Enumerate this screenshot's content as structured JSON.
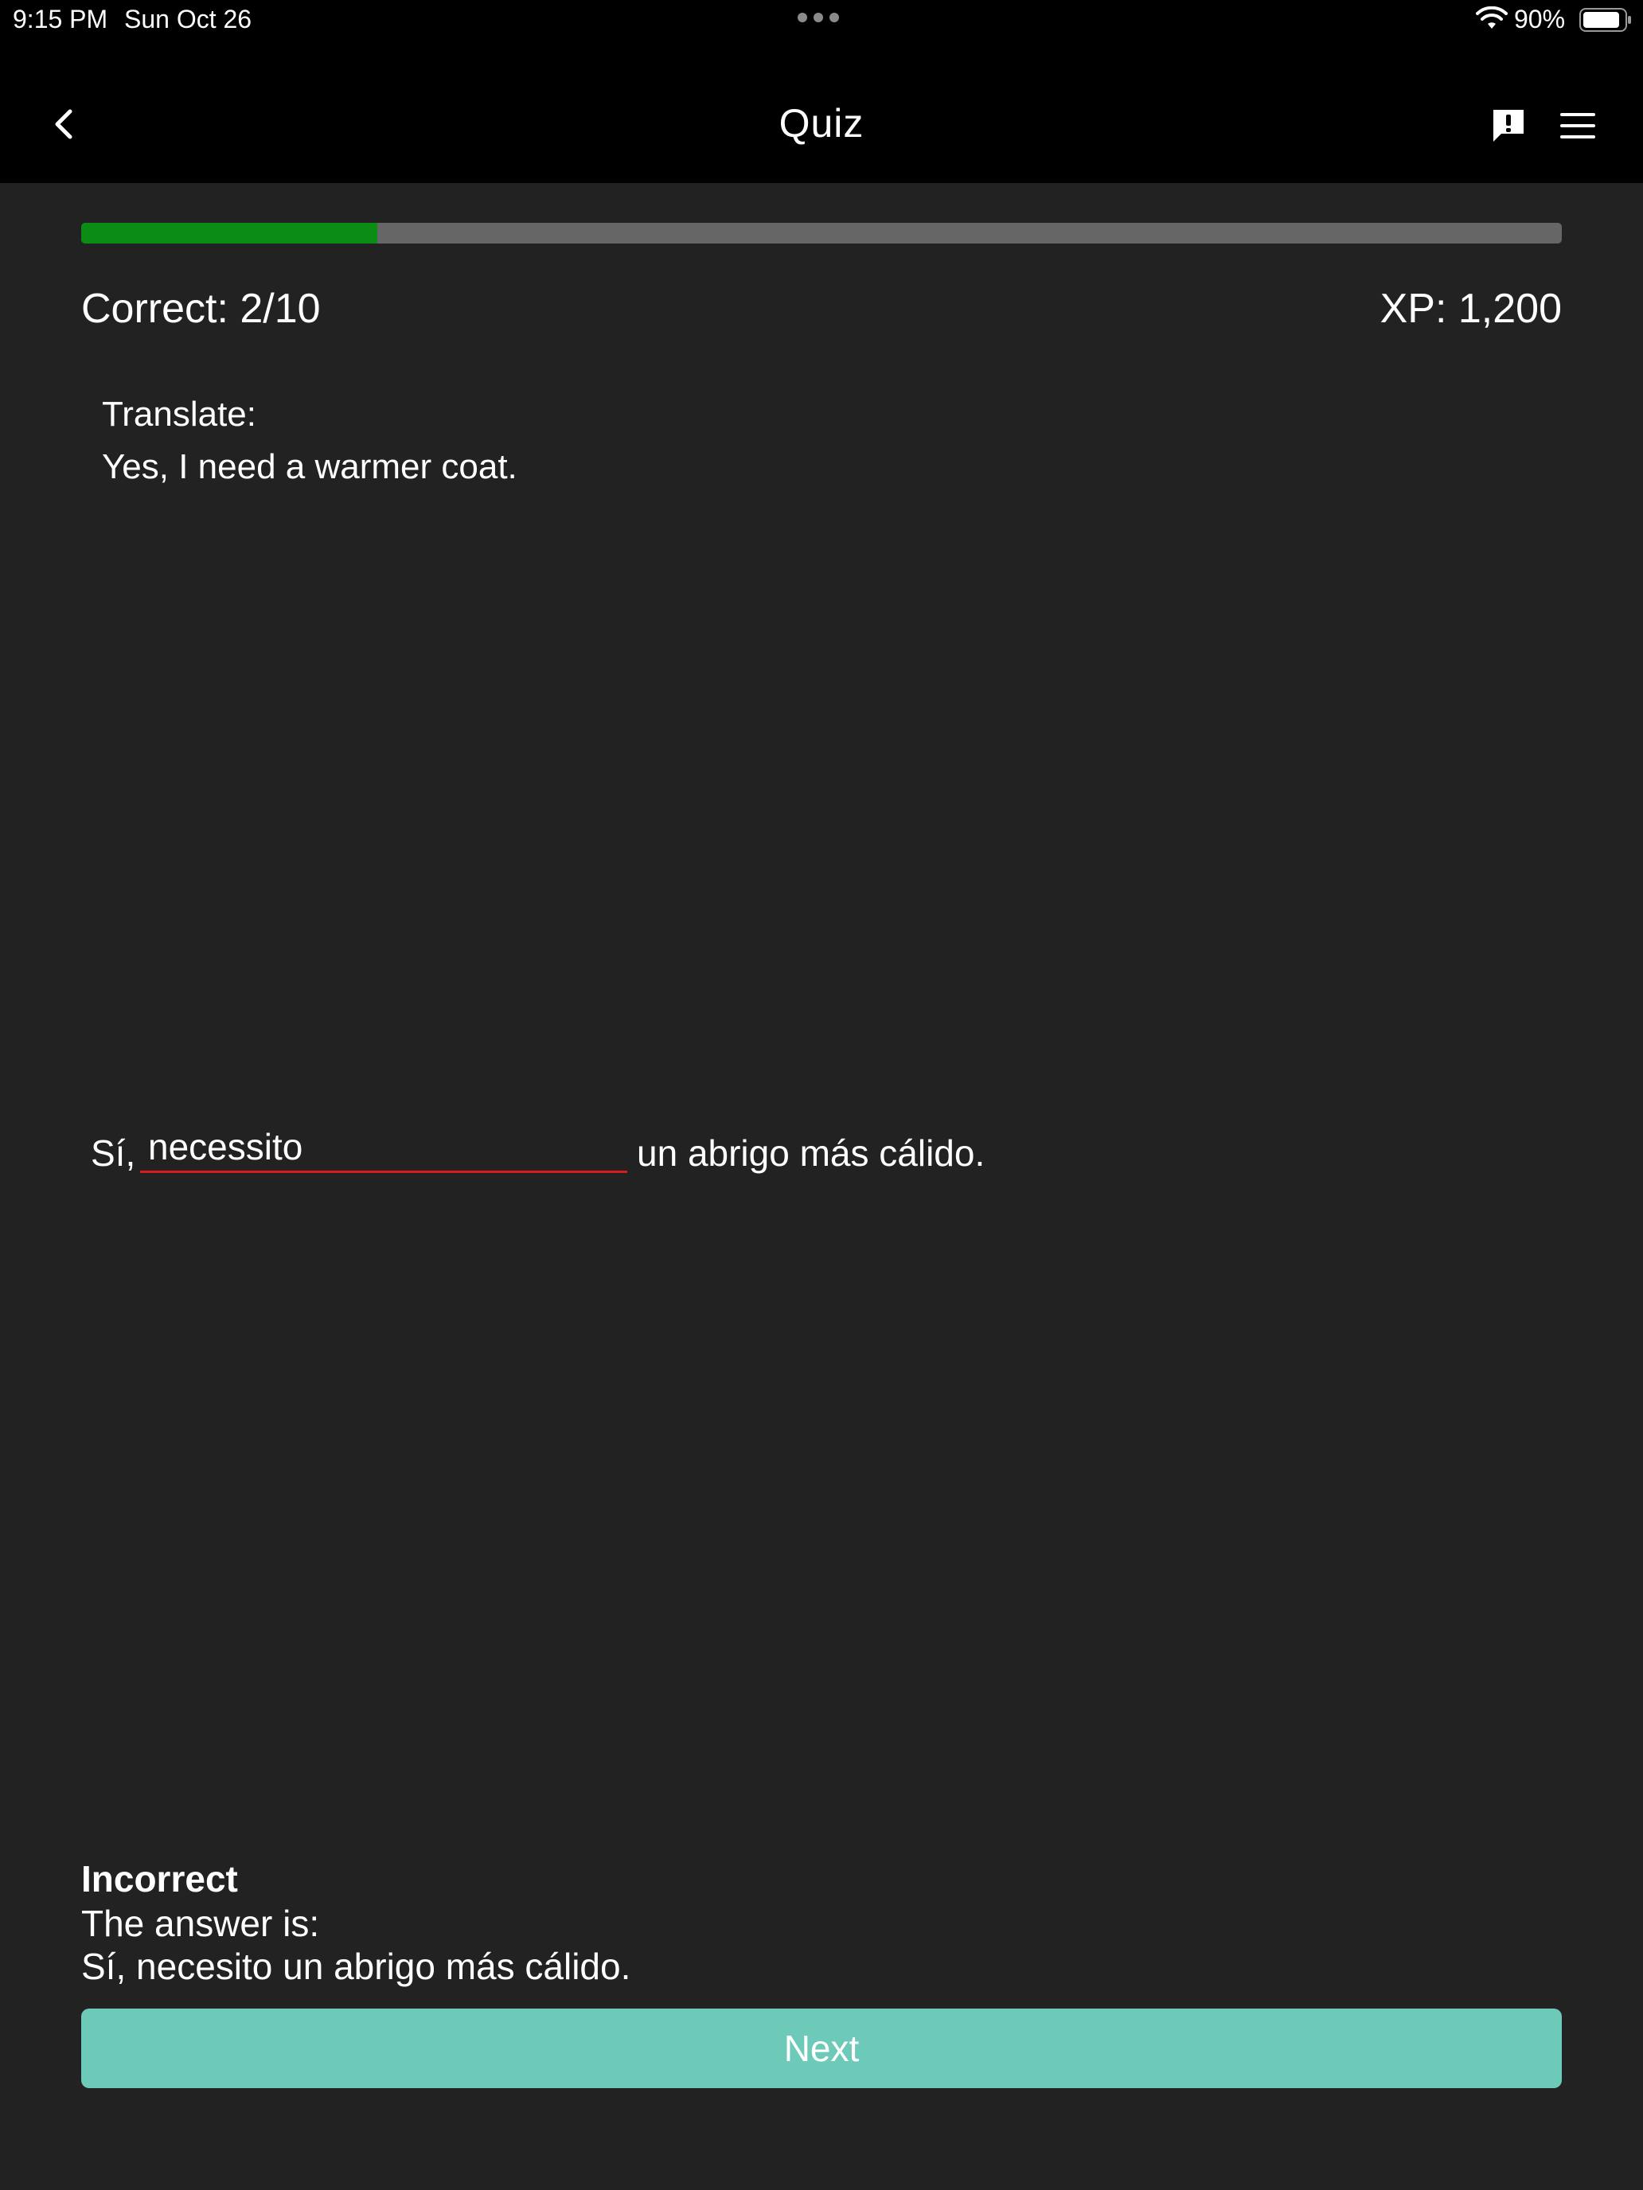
{
  "status_bar": {
    "time": "9:15 PM",
    "date": "Sun Oct 26",
    "battery_percent": "90%",
    "battery_level": 0.9
  },
  "nav": {
    "title": "Quiz",
    "back_icon": "chevron-left-icon",
    "report_icon": "report-icon",
    "menu_icon": "hamburger-menu-icon"
  },
  "progress": {
    "fraction": 0.2,
    "fill_color": "#0a8c15",
    "track_color": "#666666"
  },
  "stats": {
    "correct": "Correct: 2/10",
    "xp": "XP: 1,200"
  },
  "prompt": {
    "label": "Translate:",
    "text": "Yes, I need a warmer coat."
  },
  "exercise": {
    "prefix": "Sí,",
    "input_value": "necessito",
    "suffix": "un abrigo más cálido.",
    "input_underline_color": "#d81b1b"
  },
  "result": {
    "status": "Incorrect",
    "label": "The answer is:",
    "answer": "Sí, necesito un abrigo más cálido."
  },
  "actions": {
    "next_label": "Next",
    "next_color": "#6ecab8"
  }
}
